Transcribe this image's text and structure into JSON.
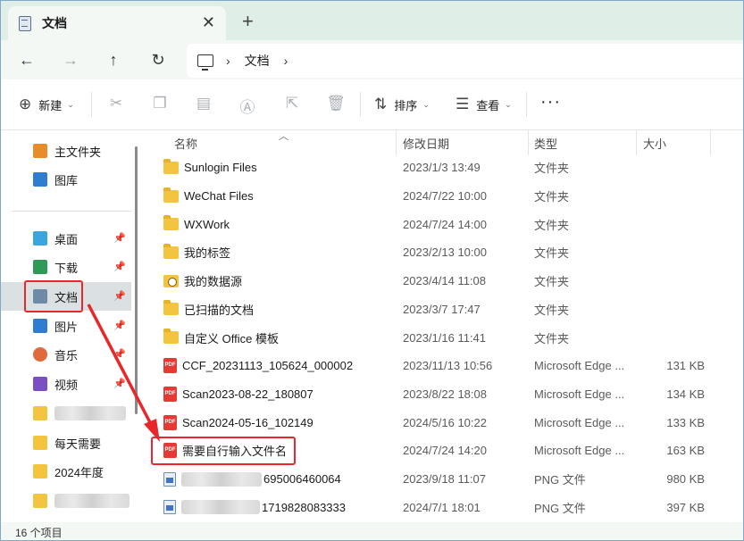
{
  "tab": {
    "title": "文档",
    "close_glyph": "✕",
    "new_glyph": "+"
  },
  "nav": {
    "back": "←",
    "forward": "→",
    "up": "↑",
    "refresh": "↻",
    "sep": "›"
  },
  "address": {
    "crumbs": [
      "文档"
    ]
  },
  "toolbar": {
    "new_label": "新建",
    "sort_label": "排序",
    "view_label": "查看",
    "more_label": "···"
  },
  "sidebar": {
    "items": [
      {
        "label": "主文件夹",
        "icon": "home-icon",
        "color": "#e88c2a"
      },
      {
        "label": "图库",
        "icon": "gallery-icon",
        "color": "#2f7cd1"
      },
      {
        "label": "桌面",
        "icon": "desktop-icon",
        "color": "#3aa6e0",
        "pinned": true
      },
      {
        "label": "下载",
        "icon": "download-icon",
        "color": "#2e9a58",
        "pinned": true
      },
      {
        "label": "文档",
        "icon": "documents-icon",
        "color": "#6f8aa6",
        "pinned": true,
        "selected": true
      },
      {
        "label": "图片",
        "icon": "pictures-icon",
        "color": "#2f7cd1",
        "pinned": true
      },
      {
        "label": "音乐",
        "icon": "music-icon",
        "color": "#e06a3c",
        "pinned": true
      },
      {
        "label": "视频",
        "icon": "video-icon",
        "color": "#7b4fc4",
        "pinned": true
      },
      {
        "label": "",
        "icon": "folder-icon",
        "color": "#f3c43f",
        "blurred": true
      },
      {
        "label": "每天需要",
        "icon": "folder-icon",
        "color": "#f3c43f"
      },
      {
        "label": "2024年度",
        "icon": "folder-icon",
        "color": "#f3c43f"
      },
      {
        "label": "",
        "icon": "folder-icon",
        "color": "#f3c43f",
        "blurred": true
      }
    ]
  },
  "columns": {
    "name": "名称",
    "date": "修改日期",
    "type": "类型",
    "size": "大小"
  },
  "files": [
    {
      "name": "Sunlogin Files",
      "date": "2023/1/3 13:49",
      "type": "文件夹",
      "size": "",
      "icon": "folder"
    },
    {
      "name": "WeChat Files",
      "date": "2024/7/22 10:00",
      "type": "文件夹",
      "size": "",
      "icon": "folder"
    },
    {
      "name": "WXWork",
      "date": "2024/7/24 14:00",
      "type": "文件夹",
      "size": "",
      "icon": "folder"
    },
    {
      "name": "我的标签",
      "date": "2023/2/13 10:00",
      "type": "文件夹",
      "size": "",
      "icon": "folder"
    },
    {
      "name": "我的数据源",
      "date": "2023/4/14 11:08",
      "type": "文件夹",
      "size": "",
      "icon": "datasrc"
    },
    {
      "name": "已扫描的文档",
      "date": "2023/3/7 17:47",
      "type": "文件夹",
      "size": "",
      "icon": "folder"
    },
    {
      "name": "自定义 Office 模板",
      "date": "2023/1/16 11:41",
      "type": "文件夹",
      "size": "",
      "icon": "folder"
    },
    {
      "name": "CCF_20231113_105624_000002",
      "date": "2023/11/13 10:56",
      "type": "Microsoft Edge ...",
      "size": "131 KB",
      "icon": "pdf"
    },
    {
      "name": "Scan2023-08-22_180807",
      "date": "2023/8/22 18:08",
      "type": "Microsoft Edge ...",
      "size": "134 KB",
      "icon": "pdf"
    },
    {
      "name": "Scan2024-05-16_102149",
      "date": "2024/5/16 10:22",
      "type": "Microsoft Edge ...",
      "size": "133 KB",
      "icon": "pdf"
    },
    {
      "name": "需要自行输入文件名",
      "date": "2024/7/24 14:20",
      "type": "Microsoft Edge ...",
      "size": "163 KB",
      "icon": "pdf"
    },
    {
      "name": "695006460064",
      "date": "2023/9/18 11:07",
      "type": "PNG 文件",
      "size": "980 KB",
      "icon": "png",
      "blurred_prefix": true
    },
    {
      "name": "1719828083333",
      "date": "2024/7/1 18:01",
      "type": "PNG 文件",
      "size": "397 KB",
      "icon": "png",
      "blurred_prefix": true
    }
  ],
  "status": {
    "item_count": "16 个项目"
  },
  "annotation": {
    "color": "#e8272a"
  }
}
